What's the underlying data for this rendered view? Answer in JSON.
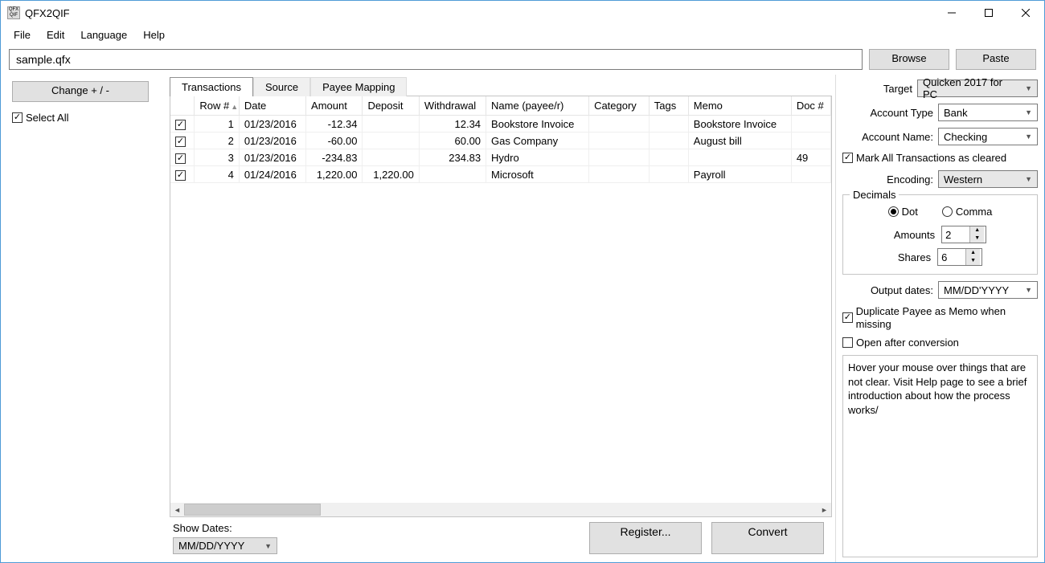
{
  "window": {
    "title": "QFX2QIF"
  },
  "menu": {
    "file": "File",
    "edit": "Edit",
    "language": "Language",
    "help": "Help"
  },
  "toolbar": {
    "file_value": "sample.qfx",
    "browse": "Browse",
    "paste": "Paste"
  },
  "left": {
    "change": "Change + / -",
    "select_all": "Select All"
  },
  "tabs": {
    "transactions": "Transactions",
    "source": "Source",
    "payee_mapping": "Payee Mapping"
  },
  "grid": {
    "headers": {
      "row": "Row #",
      "date": "Date",
      "amount": "Amount",
      "deposit": "Deposit",
      "withdrawal": "Withdrawal",
      "name": "Name (payee/r)",
      "category": "Category",
      "tags": "Tags",
      "memo": "Memo",
      "doc": "Doc #"
    },
    "rows": [
      {
        "row": "1",
        "date": "01/23/2016",
        "amount": "-12.34",
        "deposit": "",
        "withdrawal": "12.34",
        "name": "Bookstore Invoice",
        "category": "",
        "tags": "",
        "memo": "Bookstore Invoice",
        "doc": ""
      },
      {
        "row": "2",
        "date": "01/23/2016",
        "amount": "-60.00",
        "deposit": "",
        "withdrawal": "60.00",
        "name": "Gas Company",
        "category": "",
        "tags": "",
        "memo": "August bill",
        "doc": ""
      },
      {
        "row": "3",
        "date": "01/23/2016",
        "amount": "-234.83",
        "deposit": "",
        "withdrawal": "234.83",
        "name": "Hydro",
        "category": "",
        "tags": "",
        "memo": "",
        "doc": "49"
      },
      {
        "row": "4",
        "date": "01/24/2016",
        "amount": "1,220.00",
        "deposit": "1,220.00",
        "withdrawal": "",
        "name": "Microsoft",
        "category": "",
        "tags": "",
        "memo": "Payroll",
        "doc": ""
      }
    ]
  },
  "bottom": {
    "show_dates": "Show Dates:",
    "date_format": "MM/DD/YYYY",
    "register": "Register...",
    "convert": "Convert"
  },
  "right": {
    "target_label": "Target",
    "target_value": "Quicken 2017 for PC",
    "account_type_label": "Account Type",
    "account_type_value": "Bank",
    "account_name_label": "Account Name:",
    "account_name_value": "Checking",
    "mark_cleared": "Mark All Transactions as cleared",
    "encoding_label": "Encoding:",
    "encoding_value": "Western",
    "decimals_legend": "Decimals",
    "dot": "Dot",
    "comma": "Comma",
    "amounts_label": "Amounts",
    "amounts_value": "2",
    "shares_label": "Shares",
    "shares_value": "6",
    "output_dates_label": "Output dates:",
    "output_dates_value": "MM/DD'YYYY",
    "dup_payee": "Duplicate Payee as Memo when missing",
    "open_after": "Open after conversion",
    "hint": "Hover your mouse over things that are not clear. Visit Help page to see a brief introduction about how the process works/"
  }
}
